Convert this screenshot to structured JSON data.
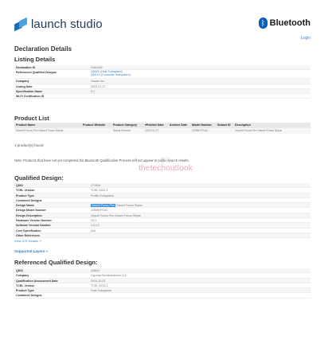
{
  "header": {
    "logo_text": "launch studio",
    "bluetooth_text": "Bluetooth",
    "login": "Login"
  },
  "page_title": "Declaration Details",
  "listing": {
    "heading": "Listing Details",
    "rows": [
      {
        "k": "Declaration ID",
        "v": "D061900"
      },
      {
        "k": "Referenced Qualified Designs",
        "v": "Q5620 (Host Subsystem)",
        "v2": "Q5XXX (Controller Subsystem)"
      },
      {
        "k": "Company",
        "v": "Xiaomi Inc."
      },
      {
        "k": "Listing Date",
        "v": "2022-01-27"
      },
      {
        "k": "Specification Name",
        "v": "5.1"
      },
      {
        "k": "Wi-Fi Certification ID",
        "v": ""
      }
    ]
  },
  "product_list": {
    "heading": "Product List",
    "columns": [
      "Product Name",
      "Product Website",
      "Product Category",
      "▾Publish Date",
      "Archive Date",
      "Model Number",
      "Subset ID",
      "Description"
    ],
    "rows": [
      [
        "Xiaomi Focus Pen Xiaomi Focus Stylus",
        "",
        "Stylus Devices",
        "2022-01-27",
        "",
        "22088YP1AC",
        "",
        "Xiaomi Focus Pen Xiaomi Focus Stylus"
      ]
    ],
    "count_text": "1 product(s) found"
  },
  "note": "Note: Products that have not yet completed the Bluetooth Qualification Process will not appear in public search results.",
  "watermark": "thetechoutlook",
  "qualified": {
    "heading": "Qualified Design:",
    "rows": [
      {
        "k": "QDID",
        "v": "271846"
      },
      {
        "k": "TCRL Version",
        "v": "TCRL 2022-1"
      },
      {
        "k": "Product Type",
        "v": "Profile Subsystem"
      },
      {
        "k": "Combined Designs",
        "v": ""
      },
      {
        "k": "Design Name",
        "v_hl": "Xiaomi Focus Pen",
        "v": "Xiaomi Focus Stylus"
      },
      {
        "k": "Design Model Number",
        "v": "22088YP1AC"
      },
      {
        "k": "Design Description",
        "v": "Xiaomi Focus Pen Xiaomi Focus Stylus"
      },
      {
        "k": "Hardware Version Number",
        "v": "V2.2"
      },
      {
        "k": "Software Version Number",
        "v": "1.0.2.2"
      },
      {
        "k": "Core Specification",
        "v": "N/A"
      },
      {
        "k": "Other References",
        "v": ""
      }
    ],
    "ics_link": "View ICS Details ↗"
  },
  "supported_layers": "Supported Layers »",
  "referenced": {
    "heading": "Referenced Qualified Design:",
    "rows": [
      {
        "k": "QDID",
        "v": "Q5620"
      },
      {
        "k": "Company",
        "v": "Cypress Semiconductor LLC"
      },
      {
        "k": "Qualification Assessment Date",
        "v": "2019-10-03"
      },
      {
        "k": "TCRL Version",
        "v": "TCRL 2019-1"
      },
      {
        "k": "Product Type",
        "v": "Host Subsystem"
      },
      {
        "k": "Combined Designs",
        "v": ""
      }
    ]
  }
}
